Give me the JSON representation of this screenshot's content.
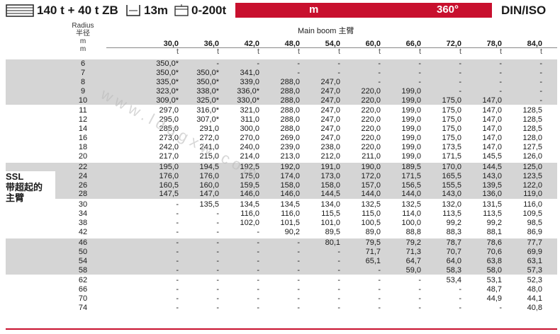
{
  "header": {
    "counterweight": "140 t + 40 t ZB",
    "boom_length": "13m",
    "superlift": "0-200t",
    "redbar_left": "",
    "redbar_unit": "m",
    "redbar_angle": "360°",
    "standard": "DIN/ISO"
  },
  "radius_header": {
    "label_en": "Radius",
    "label_cn": "半径",
    "unit": "m",
    "unit_mark": "m"
  },
  "main_boom": {
    "title": "Main boom 主臂",
    "lengths": [
      "30,0",
      "36,0",
      "42,0",
      "48,0",
      "54,0",
      "60,0",
      "66,0",
      "72,0",
      "78,0",
      "84,0"
    ],
    "unit": "t"
  },
  "ssl_label": {
    "line1": "SSL",
    "line2": "带超起的",
    "line3": "主臂"
  },
  "watermark": "www.lddgxw.com",
  "rows": [
    {
      "r": "6",
      "v": [
        "350,0*",
        "-",
        "-",
        "-",
        "-",
        "-",
        "-",
        "-",
        "-",
        "-"
      ]
    },
    {
      "r": "7",
      "v": [
        "350,0*",
        "350,0*",
        "341,0",
        "-",
        "-",
        "-",
        "-",
        "-",
        "-",
        "-"
      ]
    },
    {
      "r": "8",
      "v": [
        "335,0*",
        "350,0*",
        "339,0",
        "288,0",
        "247,0",
        "-",
        "-",
        "-",
        "-",
        "-"
      ]
    },
    {
      "r": "9",
      "v": [
        "323,0*",
        "338,0*",
        "336,0*",
        "288,0",
        "247,0",
        "220,0",
        "199,0",
        "-",
        "-",
        "-"
      ]
    },
    {
      "r": "10",
      "v": [
        "309,0*",
        "325,0*",
        "330,0*",
        "288,0",
        "247,0",
        "220,0",
        "199,0",
        "175,0",
        "147,0",
        "-"
      ]
    },
    {
      "r": "11",
      "v": [
        "297,0",
        "316,0*",
        "321,0",
        "288,0",
        "247,0",
        "220,0",
        "199,0",
        "175,0",
        "147,0",
        "128,5"
      ]
    },
    {
      "r": "12",
      "v": [
        "295,0",
        "307,0*",
        "311,0",
        "288,0",
        "247,0",
        "220,0",
        "199,0",
        "175,0",
        "147,0",
        "128,5"
      ]
    },
    {
      "r": "14",
      "v": [
        "285,0",
        "291,0",
        "300,0",
        "288,0",
        "247,0",
        "220,0",
        "199,0",
        "175,0",
        "147,0",
        "128,5"
      ]
    },
    {
      "r": "16",
      "v": [
        "273,0",
        "272,0",
        "270,0",
        "269,0",
        "247,0",
        "220,0",
        "199,0",
        "175,0",
        "147,0",
        "128,0"
      ]
    },
    {
      "r": "18",
      "v": [
        "242,0",
        "241,0",
        "240,0",
        "239,0",
        "238,0",
        "220,0",
        "199,0",
        "173,5",
        "147,0",
        "127,5"
      ]
    },
    {
      "r": "20",
      "v": [
        "217,0",
        "215,0",
        "214,0",
        "213,0",
        "212,0",
        "211,0",
        "199,0",
        "171,5",
        "145,5",
        "126,0"
      ]
    },
    {
      "r": "22",
      "v": [
        "195,0",
        "194,5",
        "192,5",
        "192,0",
        "191,0",
        "190,0",
        "189,5",
        "170,0",
        "144,5",
        "125,0"
      ]
    },
    {
      "r": "24",
      "v": [
        "176,0",
        "176,0",
        "175,0",
        "174,0",
        "173,0",
        "172,0",
        "171,5",
        "165,5",
        "143,0",
        "123,5"
      ]
    },
    {
      "r": "26",
      "v": [
        "160,5",
        "160,0",
        "159,5",
        "158,0",
        "158,0",
        "157,0",
        "156,5",
        "155,5",
        "139,5",
        "122,0"
      ]
    },
    {
      "r": "28",
      "v": [
        "147,5",
        "147,0",
        "146,0",
        "146,0",
        "144,5",
        "144,0",
        "144,0",
        "143,0",
        "136,0",
        "119,0"
      ]
    },
    {
      "r": "30",
      "v": [
        "-",
        "135,5",
        "134,5",
        "134,5",
        "134,0",
        "132,5",
        "132,5",
        "132,0",
        "131,5",
        "116,0"
      ]
    },
    {
      "r": "34",
      "v": [
        "-",
        "-",
        "116,0",
        "116,0",
        "115,5",
        "115,0",
        "114,0",
        "113,5",
        "113,5",
        "109,5"
      ]
    },
    {
      "r": "38",
      "v": [
        "-",
        "-",
        "102,0",
        "101,5",
        "101,0",
        "100,5",
        "100,0",
        "99,2",
        "99,2",
        "98,5"
      ]
    },
    {
      "r": "42",
      "v": [
        "-",
        "-",
        "-",
        "90,2",
        "89,5",
        "89,0",
        "88,8",
        "88,3",
        "88,1",
        "86,9"
      ]
    },
    {
      "r": "46",
      "v": [
        "-",
        "-",
        "-",
        "-",
        "80,1",
        "79,5",
        "79,2",
        "78,7",
        "78,6",
        "77,7"
      ]
    },
    {
      "r": "50",
      "v": [
        "-",
        "-",
        "-",
        "-",
        "-",
        "71,7",
        "71,3",
        "70,7",
        "70,6",
        "69,9"
      ]
    },
    {
      "r": "54",
      "v": [
        "-",
        "-",
        "-",
        "-",
        "-",
        "65,1",
        "64,7",
        "64,0",
        "63,8",
        "63,1"
      ]
    },
    {
      "r": "58",
      "v": [
        "-",
        "-",
        "-",
        "-",
        "-",
        "-",
        "59,0",
        "58,3",
        "58,0",
        "57,3"
      ]
    },
    {
      "r": "62",
      "v": [
        "-",
        "-",
        "-",
        "-",
        "-",
        "-",
        "-",
        "53,4",
        "53,1",
        "52,3"
      ]
    },
    {
      "r": "66",
      "v": [
        "-",
        "-",
        "-",
        "-",
        "-",
        "-",
        "-",
        "-",
        "48,7",
        "48,0"
      ]
    },
    {
      "r": "70",
      "v": [
        "-",
        "-",
        "-",
        "-",
        "-",
        "-",
        "-",
        "-",
        "44,9",
        "44,1"
      ]
    },
    {
      "r": "74",
      "v": [
        "-",
        "-",
        "-",
        "-",
        "-",
        "-",
        "-",
        "-",
        "-",
        "40,8"
      ]
    }
  ],
  "colors": {
    "accent_red": "#c8102e",
    "row_shade": "#d5d5d5"
  }
}
